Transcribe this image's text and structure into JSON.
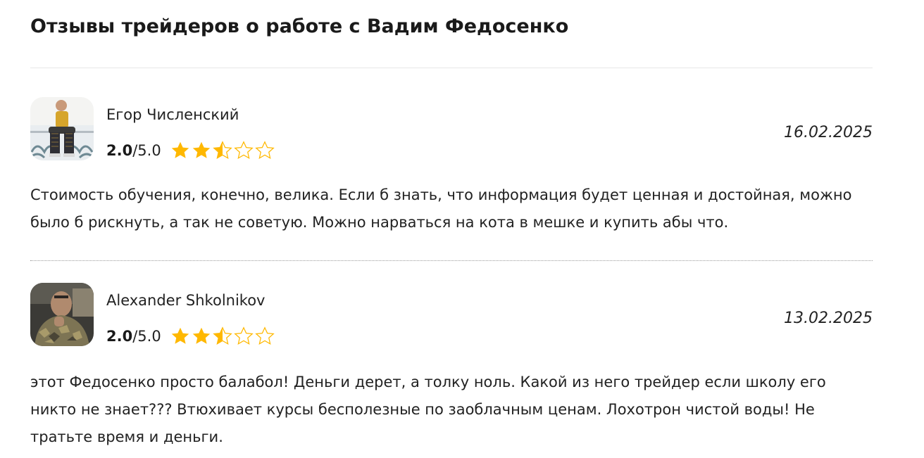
{
  "page": {
    "title": "Отзывы трейдеров о работе с Вадим Федосенко"
  },
  "colors": {
    "star_filled": "#FFB800",
    "star_outline": "#FFB800",
    "text": "#222222",
    "divider": "#9A9A9A"
  },
  "reviews": [
    {
      "author": "Егор Численский",
      "avatar_icon": "user-photo",
      "score": "2.0",
      "score_max": "/5.0",
      "stars_filled": 2.5,
      "stars_total": 5,
      "date": "16.02.2025",
      "text": "Стоимость обучения, конечно, велика. Если б знать, что информация будет ценная и достойная, можно было б рискнуть, а так не советую. Можно нарваться на кота в мешке и купить абы что."
    },
    {
      "author": "Alexander Shkolnikov",
      "avatar_icon": "user-photo",
      "score": "2.0",
      "score_max": "/5.0",
      "stars_filled": 2.5,
      "stars_total": 5,
      "date": "13.02.2025",
      "text": "этот Федосенко просто балабол! Деньги дерет, а толку ноль. Какой из него трейдер если школу его никто не знает??? Втюхивает курсы бесполезные по заоблачным ценам. Лохотрон чистой воды! Не тратьте время и деньги."
    }
  ]
}
